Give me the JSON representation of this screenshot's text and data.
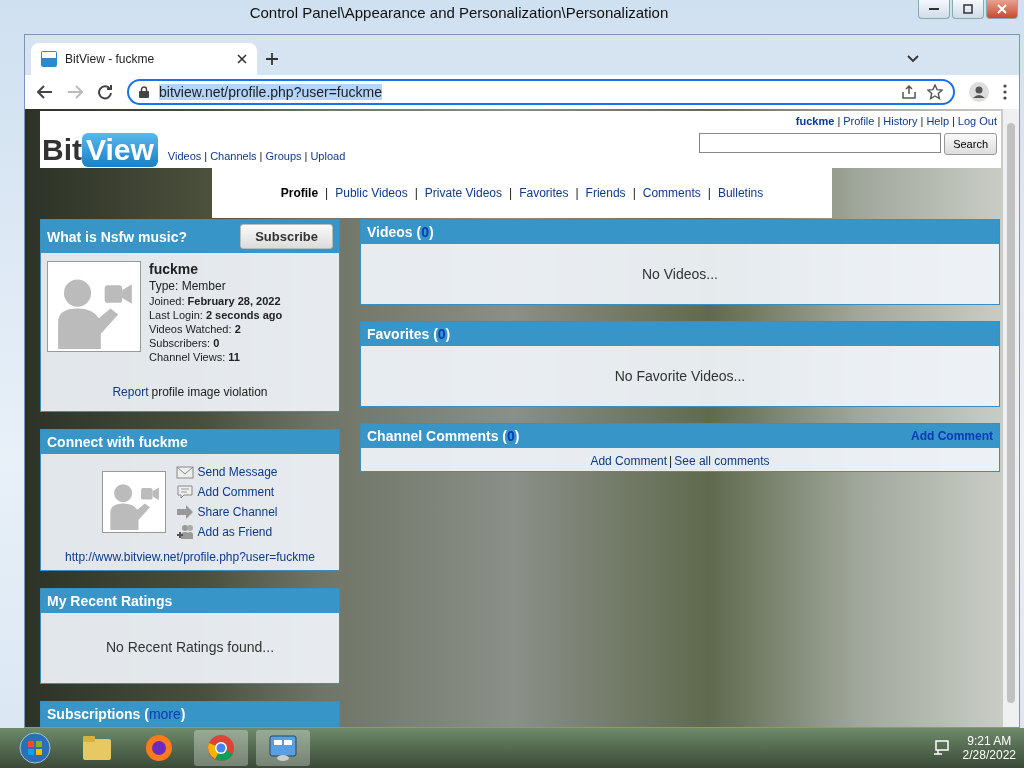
{
  "desktop_window": {
    "title": "Control Panel\\Appearance and Personalization\\Personalization"
  },
  "browser": {
    "tab_title": "BitView - fuckme",
    "address": "bitview.net/profile.php?user=fuckme"
  },
  "site": {
    "logo": {
      "first": "Bit",
      "second": "View"
    },
    "separator": "|",
    "nav": [
      "Videos",
      "Channels",
      "Groups",
      "Upload"
    ],
    "user_links": [
      {
        "label": "fuckme",
        "kind": "user"
      },
      {
        "label": "Profile",
        "kind": "link"
      },
      {
        "label": "History",
        "kind": "link"
      },
      {
        "label": "Help",
        "kind": "link"
      },
      {
        "label": "Log Out",
        "kind": "link"
      }
    ],
    "search_button": "Search"
  },
  "profile_tabs": [
    {
      "label": "Profile",
      "selected": true
    },
    {
      "label": "Public Videos",
      "selected": false
    },
    {
      "label": "Private Videos",
      "selected": false
    },
    {
      "label": "Favorites",
      "selected": false
    },
    {
      "label": "Friends",
      "selected": false
    },
    {
      "label": "Comments",
      "selected": false
    },
    {
      "label": "Bulletins",
      "selected": false
    }
  ],
  "profile_box": {
    "title": "What is Nsfw music?",
    "subscribe": "Subscribe",
    "username": "fuckme",
    "type": "Type: Member",
    "stats": [
      {
        "label": "Joined:",
        "value": "February 28, 2022"
      },
      {
        "label": "Last Login:",
        "value": "2 seconds ago"
      },
      {
        "label": "Videos Watched:",
        "value": "2"
      },
      {
        "label": "Subscribers:",
        "value": "0"
      },
      {
        "label": "Channel Views:",
        "value": "11"
      }
    ],
    "report_link": "Report",
    "report_text": "profile image violation"
  },
  "connect": {
    "title": "Connect with fuckme",
    "actions": [
      {
        "label": "Send Message",
        "kind": "message"
      },
      {
        "label": "Add Comment",
        "kind": "comment"
      },
      {
        "label": "Share Channel",
        "kind": "share"
      },
      {
        "label": "Add as Friend",
        "kind": "friend"
      }
    ],
    "url": "http://www.bitview.net/profile.php?user=fuckme"
  },
  "ratings": {
    "title": "My Recent Ratings",
    "empty": "No Recent Ratings found..."
  },
  "subscriptions": {
    "title": "Subscriptions (",
    "more": "more",
    "suffix": ")"
  },
  "sections": [
    {
      "title": "Videos (",
      "count": "0",
      "suffix": ")",
      "empty": "No Videos..."
    },
    {
      "title": "Favorites (",
      "count": "0",
      "suffix": ")",
      "empty": "No Favorite Videos..."
    }
  ],
  "comments": {
    "title": "Channel Comments (",
    "count": "0",
    "suffix": ")",
    "header_link": "Add Comment",
    "links": [
      "Add Comment",
      "See all comments"
    ],
    "separator": "|"
  },
  "taskbar": {
    "time": "9:21 AM",
    "date": "2/28/2022"
  }
}
